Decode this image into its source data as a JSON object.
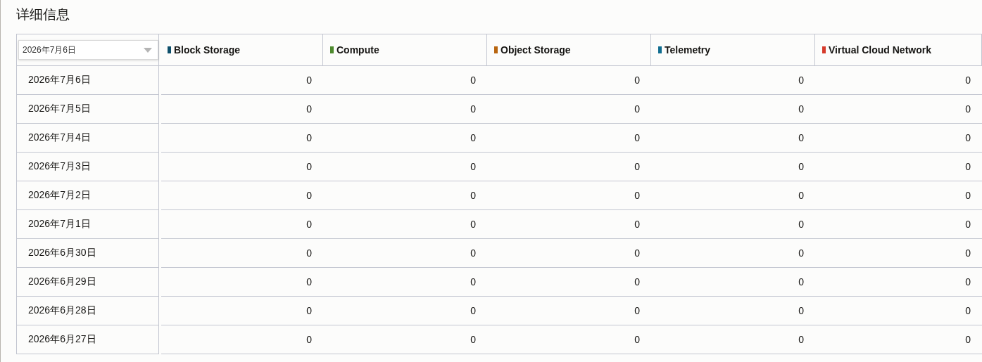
{
  "title": "详细信息",
  "date_dropdown": {
    "value": "2026年7月6日"
  },
  "columns": [
    {
      "label": "Block Storage",
      "color": "#0d4f6b"
    },
    {
      "label": "Compute",
      "color": "#4e8a2e"
    },
    {
      "label": "Object Storage",
      "color": "#b8650f"
    },
    {
      "label": "Telemetry",
      "color": "#106d90"
    },
    {
      "label": "Virtual Cloud Network",
      "color": "#d63b2b"
    }
  ],
  "rows": [
    {
      "date": "2026年7月6日",
      "values": [
        "0",
        "0",
        "0",
        "0",
        "0"
      ]
    },
    {
      "date": "2026年7月5日",
      "values": [
        "0",
        "0",
        "0",
        "0",
        "0"
      ]
    },
    {
      "date": "2026年7月4日",
      "values": [
        "0",
        "0",
        "0",
        "0",
        "0"
      ]
    },
    {
      "date": "2026年7月3日",
      "values": [
        "0",
        "0",
        "0",
        "0",
        "0"
      ]
    },
    {
      "date": "2026年7月2日",
      "values": [
        "0",
        "0",
        "0",
        "0",
        "0"
      ]
    },
    {
      "date": "2026年7月1日",
      "values": [
        "0",
        "0",
        "0",
        "0",
        "0"
      ]
    },
    {
      "date": "2026年6月30日",
      "values": [
        "0",
        "0",
        "0",
        "0",
        "0"
      ]
    },
    {
      "date": "2026年6月29日",
      "values": [
        "0",
        "0",
        "0",
        "0",
        "0"
      ]
    },
    {
      "date": "2026年6月28日",
      "values": [
        "0",
        "0",
        "0",
        "0",
        "0"
      ]
    },
    {
      "date": "2026年6月27日",
      "values": [
        "0",
        "0",
        "0",
        "0",
        "0"
      ]
    }
  ]
}
